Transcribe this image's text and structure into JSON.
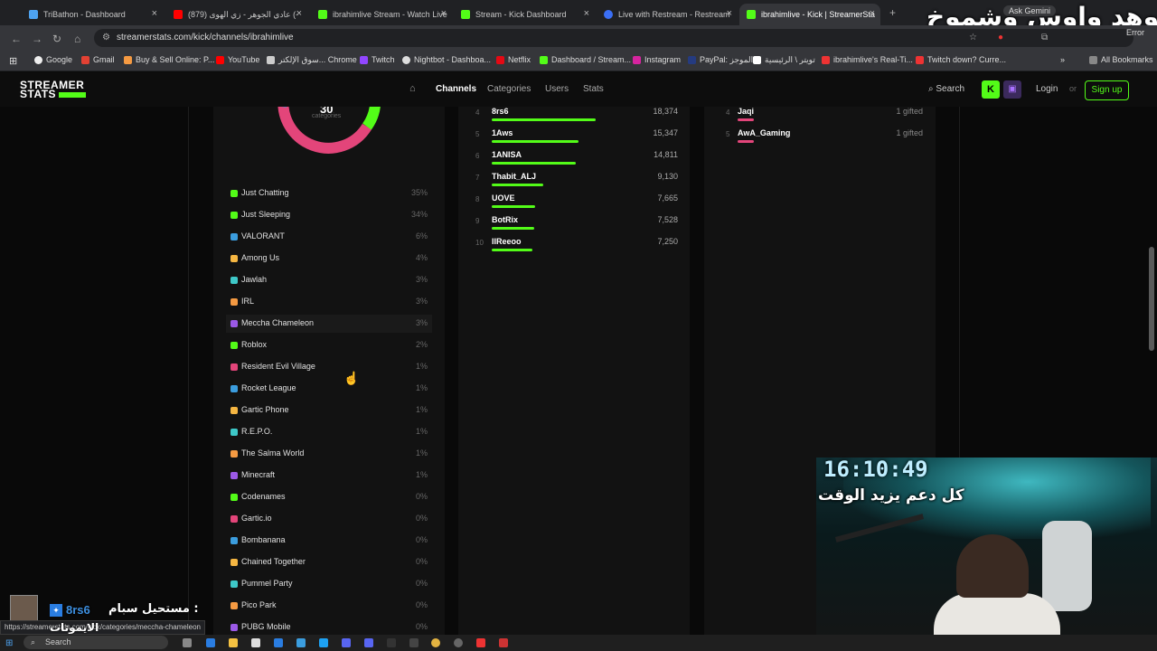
{
  "browser": {
    "tabs": [
      {
        "title": "TriBathon - Dashboard",
        "color": "#4ea3f0"
      },
      {
        "title": "(879) عادي الجوهر - زي الهوى (-",
        "color": "#ff0000"
      },
      {
        "title": "ibrahimlive Stream - Watch Live",
        "color": "#53fc18"
      },
      {
        "title": "Stream - Kick Dashboard",
        "color": "#53fc18"
      },
      {
        "title": "Live with Restream - Restream",
        "color": "#3b6ff5"
      },
      {
        "title": "ibrahimlive - Kick | StreamerSta",
        "color": "#53fc18"
      }
    ],
    "gemini": "Ask Gemini",
    "url": "streamerstats.com/kick/channels/ibrahimlive",
    "error_label": "Error",
    "bookmarks": [
      "Google",
      "Gmail",
      "Buy & Sell Online: P...",
      "YouTube",
      "سوق الإلكتر... Chrome",
      "Twitch",
      "Nightbot - Dashboa...",
      "Netflix",
      "Dashboard / Stream...",
      "Instagram",
      "PayPal: الموجز",
      "تويتر \\ الرئيسية",
      "ibrahimlive's Real-Ti...",
      "Twitch down? Curre..."
    ],
    "all_bookmarks": "All Bookmarks",
    "status_url": "https://streamerstats.com/kick/categories/meccha-chameleon"
  },
  "overlay": {
    "title": "موهد واوس وشموخ",
    "timer": "16:10:49",
    "subtitle": "كل دعم يزيد الوقت",
    "alert_name": "8rs6",
    "alert_msg": "مستحيل سبام :",
    "alert_sub": "الايموتات"
  },
  "site": {
    "logo_top": "STREAMER",
    "logo_bottom": "STATS",
    "nav": [
      "Channels",
      "Categories",
      "Users",
      "Stats"
    ],
    "search": "Search",
    "login": "Login",
    "or": "or",
    "signup": "Sign up"
  },
  "donut": {
    "total": "30",
    "label": "categories"
  },
  "categories": [
    {
      "name": "Just Chatting",
      "pct": "35%",
      "color": "#53fc18"
    },
    {
      "name": "Just Sleeping",
      "pct": "34%",
      "color": "#53fc18"
    },
    {
      "name": "VALORANT",
      "pct": "6%",
      "color": "#3b9dde"
    },
    {
      "name": "Among Us",
      "pct": "4%",
      "color": "#f5b642"
    },
    {
      "name": "Jawlah",
      "pct": "3%",
      "color": "#3ec8c8"
    },
    {
      "name": "IRL",
      "pct": "3%",
      "color": "#f59a42"
    },
    {
      "name": "Meccha Chameleon",
      "pct": "3%",
      "color": "#9b59e6"
    },
    {
      "name": "Roblox",
      "pct": "2%",
      "color": "#53fc18"
    },
    {
      "name": "Resident Evil Village",
      "pct": "1%",
      "color": "#e3457a"
    },
    {
      "name": "Rocket League",
      "pct": "1%",
      "color": "#3b9dde"
    },
    {
      "name": "Gartic Phone",
      "pct": "1%",
      "color": "#f5b642"
    },
    {
      "name": "R.E.P.O.",
      "pct": "1%",
      "color": "#3ec8c8"
    },
    {
      "name": "The Salma World",
      "pct": "1%",
      "color": "#f59a42"
    },
    {
      "name": "Minecraft",
      "pct": "1%",
      "color": "#9b59e6"
    },
    {
      "name": "Codenames",
      "pct": "0%",
      "color": "#53fc18"
    },
    {
      "name": "Gartic.io",
      "pct": "0%",
      "color": "#e3457a"
    },
    {
      "name": "Bombanana",
      "pct": "0%",
      "color": "#3b9dde"
    },
    {
      "name": "Chained Together",
      "pct": "0%",
      "color": "#f5b642"
    },
    {
      "name": "Pummel Party",
      "pct": "0%",
      "color": "#3ec8c8"
    },
    {
      "name": "Pico Park",
      "pct": "0%",
      "color": "#f59a42"
    },
    {
      "name": "PUBG Mobile",
      "pct": "0%",
      "color": "#9b59e6"
    }
  ],
  "viewers": [
    {
      "rank": "4",
      "name": "8rs6",
      "value": "18,374",
      "share": 1.0
    },
    {
      "rank": "5",
      "name": "1Aws",
      "value": "15,347",
      "share": 0.835
    },
    {
      "rank": "6",
      "name": "1ANISA",
      "value": "14,811",
      "share": 0.806
    },
    {
      "rank": "7",
      "name": "Thabit_ALJ",
      "value": "9,130",
      "share": 0.497
    },
    {
      "rank": "8",
      "name": "UOVE",
      "value": "7,665",
      "share": 0.417
    },
    {
      "rank": "9",
      "name": "BotRix",
      "value": "7,528",
      "share": 0.41
    },
    {
      "rank": "10",
      "name": "IIReeoo",
      "value": "7,250",
      "share": 0.395
    }
  ],
  "gifters": [
    {
      "rank": "4",
      "name": "Jaqi",
      "value": "1 gifted"
    },
    {
      "rank": "5",
      "name": "AwA_Gaming",
      "value": "1 gifted"
    }
  ],
  "taskbar": {
    "search": "Search"
  }
}
